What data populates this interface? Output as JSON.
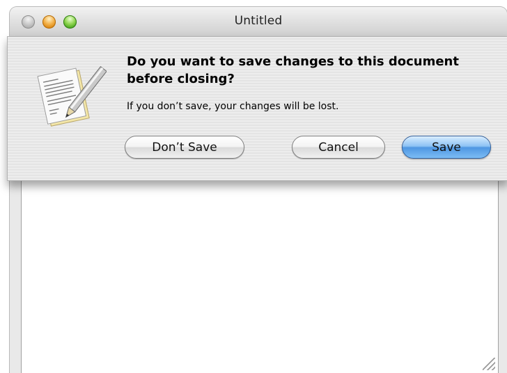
{
  "window": {
    "title": "Untitled"
  },
  "dialog": {
    "heading_line1": "Do you want to save changes to this document",
    "heading_line2": "before closing?",
    "message": "If you don’t save, your changes will be lost.",
    "icon": "textedit-document-icon",
    "buttons": {
      "dont_save": "Don’t Save",
      "cancel": "Cancel",
      "save": "Save"
    },
    "default_button_color": "#4f97e2"
  }
}
